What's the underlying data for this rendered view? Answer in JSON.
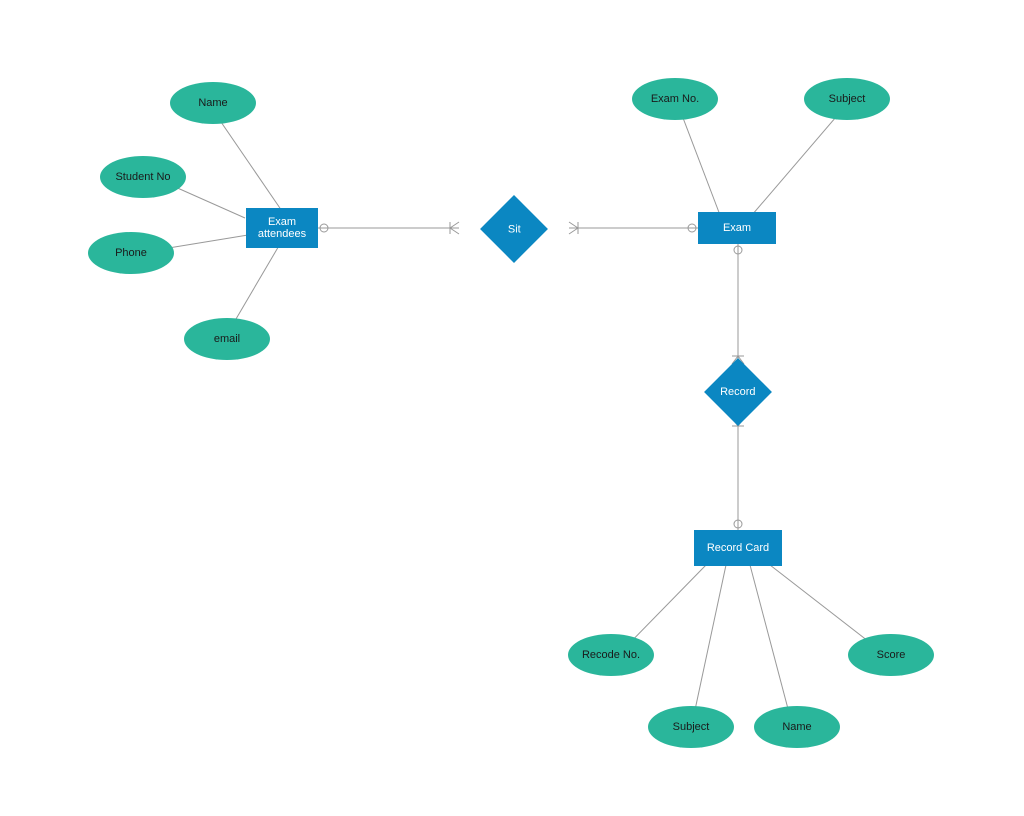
{
  "entities": {
    "examAttendees": "Exam attendees",
    "exam": "Exam",
    "recordCard": "Record Card"
  },
  "relationships": {
    "sit": "Sit",
    "record": "Record"
  },
  "attributes": {
    "name": "Name",
    "studentNo": "Student No",
    "phone": "Phone",
    "email": "email",
    "examNo": "Exam No.",
    "subject": "Subject",
    "recodeNo": "Recode No.",
    "subject2": "Subject",
    "name2": "Name",
    "score": "Score"
  }
}
